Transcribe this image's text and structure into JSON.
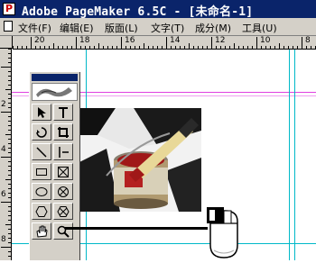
{
  "window": {
    "title": "Adobe PageMaker 6.5C - [未命名-1]"
  },
  "menu": {
    "items": [
      "文件(F)",
      "编辑(E)",
      "版面(L)",
      "文字(T)",
      "成分(M)",
      "工具(U)"
    ]
  },
  "ruler_top": {
    "labels": [
      "20",
      "18",
      "16",
      "14",
      "12",
      "10",
      "8"
    ]
  },
  "ruler_left": {
    "labels": [
      "2",
      "4",
      "6",
      "8"
    ]
  },
  "toolbox": {
    "tools": [
      "pointer-tool",
      "text-tool",
      "rotate-tool",
      "crop-tool",
      "line-tool",
      "constrained-line-tool",
      "rectangle-tool",
      "rectangle-frame-tool",
      "ellipse-tool",
      "ellipse-frame-tool",
      "polygon-tool",
      "polygon-frame-tool",
      "hand-tool",
      "zoom-tool"
    ],
    "highlighted_tool": "polygon-frame-tool"
  },
  "colors": {
    "titlebar": "#0a246a",
    "chrome": "#d4d0c8",
    "guide_cyan": "#00b8c8",
    "guide_magenta": "#e040e0"
  }
}
